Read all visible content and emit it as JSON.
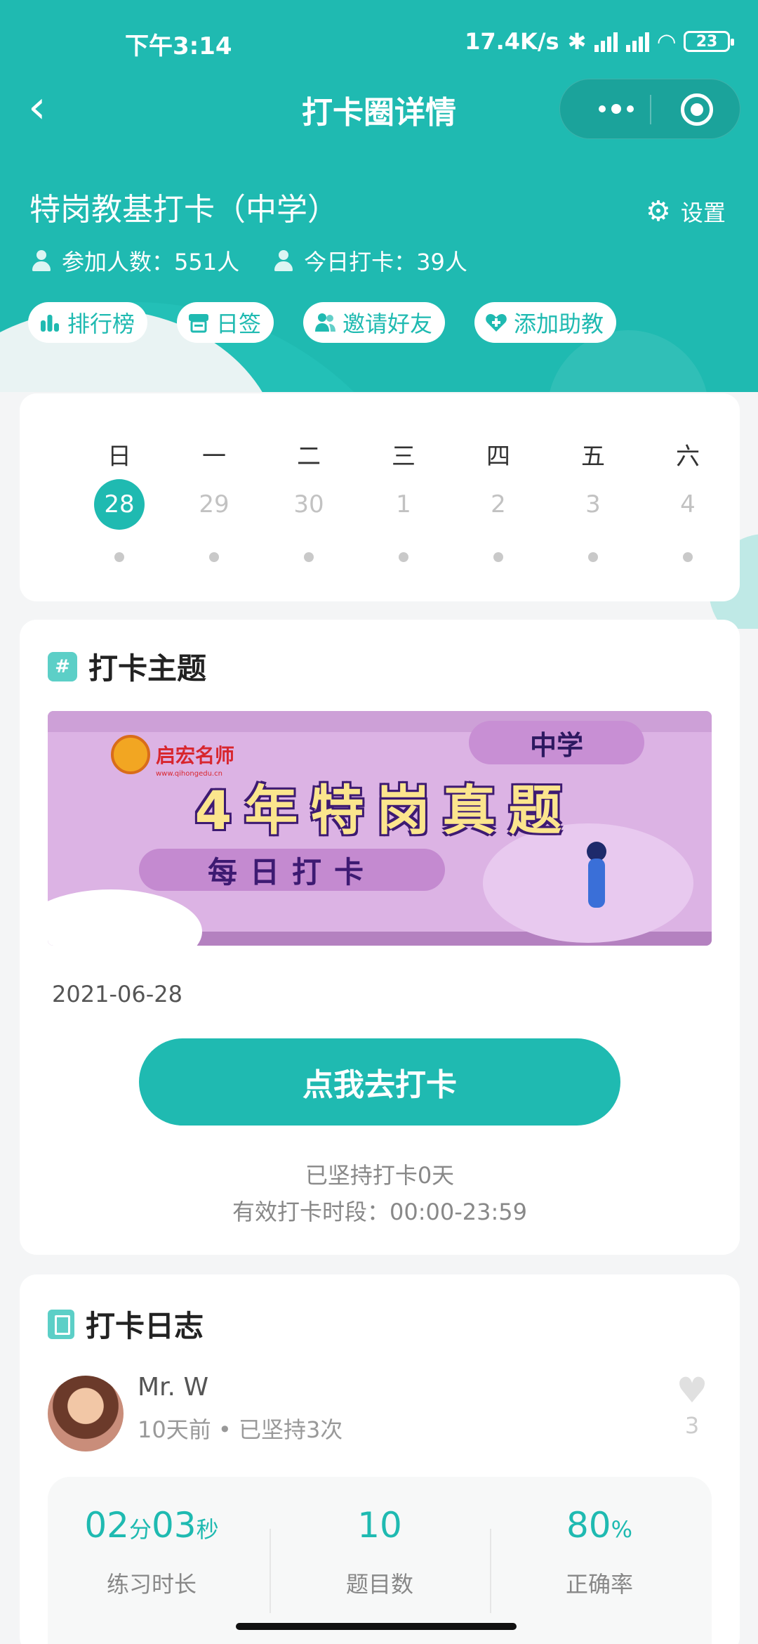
{
  "status_bar": {
    "time": "下午3:14",
    "speed": "17.4K/s",
    "battery": "23"
  },
  "nav": {
    "title": "打卡圈详情"
  },
  "circle": {
    "name": "特岗教基打卡（中学）",
    "settings_label": "设置",
    "members": "参加人数：551人",
    "today_checkins": "今日打卡：39人"
  },
  "actions": [
    {
      "label": "排行榜",
      "icon": "bar-chart-icon"
    },
    {
      "label": "日签",
      "icon": "calendar-sign-icon"
    },
    {
      "label": "邀请好友",
      "icon": "invite-friends-icon"
    },
    {
      "label": "添加助教",
      "icon": "add-assistant-icon"
    }
  ],
  "calendar": {
    "days": [
      {
        "name": "日",
        "num": "28",
        "active": true
      },
      {
        "name": "一",
        "num": "29"
      },
      {
        "name": "二",
        "num": "30"
      },
      {
        "name": "三",
        "num": "1"
      },
      {
        "name": "四",
        "num": "2"
      },
      {
        "name": "五",
        "num": "3"
      },
      {
        "name": "六",
        "num": "4"
      }
    ]
  },
  "theme": {
    "title": "打卡主题",
    "hash": "#",
    "banner": {
      "brand": "启宏名师",
      "brand_url": "www.qihongedu.cn",
      "tag": "中学",
      "headline": "4年特岗真题",
      "sub": "每日打卡"
    },
    "date": "2021-06-28",
    "cta": "点我去打卡",
    "streak": "已坚持打卡0天",
    "period": "有效打卡时段：00:00-23:59"
  },
  "log": {
    "title": "打卡日志",
    "user_name": "Mr. W",
    "user_meta": "10天前 • 已坚持3次",
    "likes": "3",
    "stats": {
      "duration_min": "02",
      "duration_min_unit": "分",
      "duration_sec": "03",
      "duration_sec_unit": "秒",
      "duration_label": "练习时长",
      "questions": "10",
      "questions_label": "题目数",
      "accuracy": "80",
      "accuracy_unit": "%",
      "accuracy_label": "正确率"
    }
  },
  "colors": {
    "primary": "#1fbab1",
    "text": "#333333",
    "muted": "#888888"
  }
}
